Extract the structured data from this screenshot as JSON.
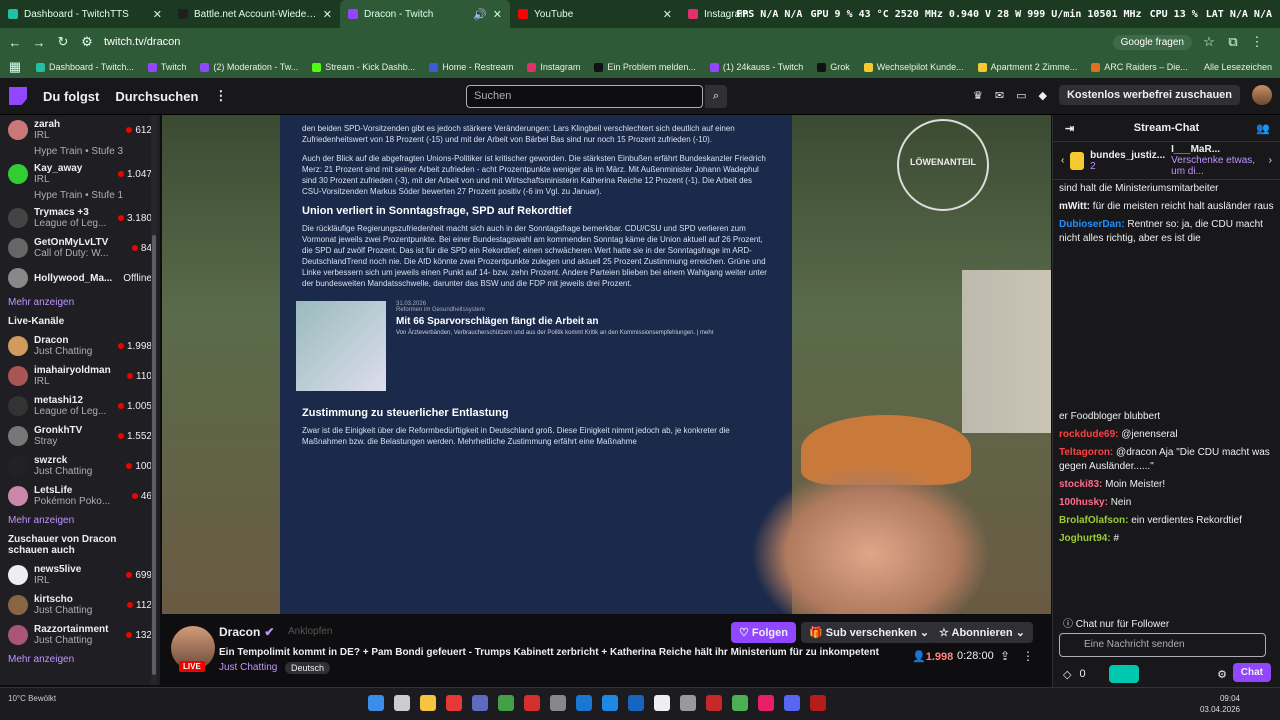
{
  "browser": {
    "tabs": [
      {
        "title": "Dashboard - TwitchTTS",
        "color": "#20c0a0"
      },
      {
        "title": "Battle.net Account-Wiederherst",
        "color": "#202020"
      },
      {
        "title": "Dracon - Twitch",
        "color": "#9147ff"
      },
      {
        "title": "YouTube",
        "color": "#ff0000"
      },
      {
        "title": "Instagram",
        "color": "#e1306c"
      }
    ],
    "overlay": [
      "FPS N/A N/A",
      "GPU 9 % 43 °C 2520 MHz 0.940 V 28 W 999 U/min 10501 MHz",
      "CPU 13 %",
      "LAT N/A N/A"
    ],
    "url": "twitch.tv/dracon",
    "google_btn": "Google fragen",
    "bookmarks": [
      "Dashboard - Twitch...",
      "Twitch",
      "(2) Moderation - Tw...",
      "Stream - Kick Dashb...",
      "Home - Restream",
      "Instagram",
      "Ein Problem melden...",
      "(1) 24kauss - Twitch",
      "Grok",
      "Wechselpilot Kunde...",
      "Apartment 2 Zimme...",
      "ARC Raiders – Die..."
    ],
    "all_bookmarks": "Alle Lesezeichen"
  },
  "topnav": {
    "following": "Du folgst",
    "browse": "Durchsuchen",
    "search_placeholder": "Suchen",
    "promo": "Kostenlos werbefrei zuschauen"
  },
  "sidebar": {
    "followed": [
      {
        "name": "zarah",
        "cat": "IRL",
        "count": "612",
        "hype": "Hype Train • Stufe 3",
        "color": "#c77"
      },
      {
        "name": "Kay_away",
        "cat": "IRL",
        "count": "1.047",
        "hype": "Hype Train • Stufe 1",
        "color": "#3c3"
      },
      {
        "name": "Trymacs +3",
        "cat": "League of Leg...",
        "count": "3.180",
        "hype": "",
        "color": "#444"
      },
      {
        "name": "GetOnMyLvLTV",
        "cat": "Call of Duty: W...",
        "count": "84",
        "hype": "",
        "color": "#666"
      },
      {
        "name": "Hollywood_Ma...",
        "cat": "",
        "count": "Offline",
        "hype": "",
        "color": "#888"
      }
    ],
    "more1": "Mehr anzeigen",
    "live_header": "Live-Kanäle",
    "live": [
      {
        "name": "Dracon",
        "cat": "Just Chatting",
        "count": "1.998",
        "color": "#d29a5c"
      },
      {
        "name": "imahairyoldman",
        "cat": "IRL",
        "count": "110",
        "color": "#a55"
      },
      {
        "name": "metashi12",
        "cat": "League of Leg...",
        "count": "1.005",
        "color": "#333"
      },
      {
        "name": "GronkhTV",
        "cat": "Stray",
        "count": "1.552",
        "color": "#777"
      },
      {
        "name": "swzrck",
        "cat": "Just Chatting",
        "count": "100",
        "color": "#222"
      },
      {
        "name": "LetsLife",
        "cat": "Pokémon Poko...",
        "count": "46",
        "color": "#c8a"
      }
    ],
    "more2": "Mehr anzeigen",
    "viewers_header": "Zuschauer von Dracon schauen auch",
    "also": [
      {
        "name": "news5live",
        "cat": "IRL",
        "count": "699",
        "color": "#eee"
      },
      {
        "name": "kirtscho",
        "cat": "Just Chatting",
        "count": "112",
        "color": "#864"
      },
      {
        "name": "Razzortainment",
        "cat": "Just Chatting",
        "count": "132",
        "color": "#a57"
      }
    ],
    "more3": "Mehr anzeigen"
  },
  "article": {
    "p1": "den beiden SPD-Vorsitzenden gibt es jedoch stärkere Veränderungen: Lars Klingbeil verschlechtert sich deutlich auf einen Zufriedenheitswert von 18 Prozent (-15) und mit der Arbeit von Bärbel Bas sind nur noch 15 Prozent zufrieden (-10).",
    "p2": "Auch der Blick auf die abgefragten Unions-Politiker ist kritischer geworden. Die stärksten Einbußen erfährt Bundeskanzler Friedrich Merz: 21 Prozent sind mit seiner Arbeit zufrieden - acht Prozentpunkte weniger als im März. Mit Außenminister Johann Wadephul sind 30 Prozent zufrieden (-3), mit der Arbeit von und mit Wirtschaftsministerin Katherina Reiche 12 Prozent (-1). Die Arbeit des CSU-Vorsitzenden Markus Söder bewerten 27 Prozent positiv (-6 im Vgl. zu Januar).",
    "h1": "Union verliert in Sonntagsfrage, SPD auf Rekordtief",
    "p3": "Die rückläufige Regierungszufriedenheit macht sich auch in der Sonntagsfrage bemerkbar. CDU/CSU und SPD verlieren zum Vormonat jeweils zwei Prozentpunkte. Bei einer Bundestagswahl am kommenden Sonntag käme die Union aktuell auf 26 Prozent, die SPD auf zwölf Prozent. Das ist für die SPD ein Rekordtief; einen schwächeren Wert hatte sie in der Sonntagsfrage im ARD-DeutschlandTrend noch nie. Die AfD könnte zwei Prozentpunkte zulegen und aktuell 25 Prozent Zustimmung erreichen. Grüne und Linke verbessern sich um jeweils einen Punkt auf 14- bzw. zehn Prozent. Andere Parteien blieben bei einem Wahlgang weiter unter der bundesweiten Mandatsschwelle, darunter das BSW und die FDP mit jeweils drei Prozent.",
    "news_date": "31.03.2026",
    "news_kicker": "Reformen im Gesundheitssystem",
    "news_title": "Mit 66 Sparvorschlägen fängt die Arbeit an",
    "news_body": "Von Ärzteverbänden, Verbraucherschützern und aus der Politik kommt Kritik an den Kommissionsempfehlungen. | mehr",
    "h2": "Zustimmung zu steuerlicher Entlastung",
    "p4": "Zwar ist die Einigkeit über die Reformbedürftigkeit in Deutschland groß. Diese Einigkeit nimmt jedoch ab, je konkreter die Maßnahmen bzw. die Belastungen werden. Mehrheitliche Zustimmung erfährt eine Maßnahme",
    "logo": "LÖWENANTEIL"
  },
  "stream": {
    "channel": "Dracon",
    "notify": "Anklopfen",
    "live": "LIVE",
    "title": "Ein Tempolimit kommt in DE? + Pam Bondi gefeuert - Trumps Kabinett zerbricht + Katherina Reiche hält ihr Ministerium für zu inkompetent",
    "category": "Just Chatting",
    "language": "Deutsch",
    "follow": "Folgen",
    "gift": "Sub verschenken",
    "subscribe": "Abonnieren",
    "viewers": "1.998",
    "uptime": "0:28:00"
  },
  "chat": {
    "header": "Stream-Chat",
    "pinned_user": "bundes_justiz...",
    "pinned_count": "2",
    "pinned_user2": "I___MaR...",
    "pinned_count2": "1",
    "pinned_msg": "Verschenke etwas, um di...",
    "messages": [
      {
        "user": "",
        "color": "#efeff1",
        "text": "sind halt die Ministeriumsmitarbeiter"
      },
      {
        "user": "mWitt:",
        "color": "#efeff1",
        "text": " für die meisten reicht halt ausländer raus"
      },
      {
        "user": "DubioserDan:",
        "color": "#1e90ff",
        "text": " Rentner so: ja, die CDU macht nicht alles richtig, aber es ist die"
      },
      {
        "user": "",
        "color": "#efeff1",
        "text": "er Foodbloger blubbert"
      },
      {
        "user": "rockdude69:",
        "color": "#ff4040",
        "text": " @jenenseral"
      },
      {
        "user": "Teltagoron:",
        "color": "#ff4040",
        "text": " @dracon Aja \"Die CDU macht was gegen Ausländer......\""
      },
      {
        "user": "stocki83:",
        "color": "#ff6b8a",
        "text": " Moin Meister!"
      },
      {
        "user": "100husky:",
        "color": "#ff6b8a",
        "text": " Nein"
      },
      {
        "user": "BrolafOlafson:",
        "color": "#9acd32",
        "text": " ein verdientes Rekordtief"
      },
      {
        "user": "Joghurt94:",
        "color": "#9acd32",
        "text": " #"
      }
    ],
    "follower_only": "Chat nur für Follower",
    "input_placeholder": "Eine Nachricht senden",
    "points": "0",
    "send": "Chat"
  },
  "taskbar": {
    "weather": "10°C Bewölkt",
    "time": "09:04",
    "date": "03.04.2026"
  }
}
